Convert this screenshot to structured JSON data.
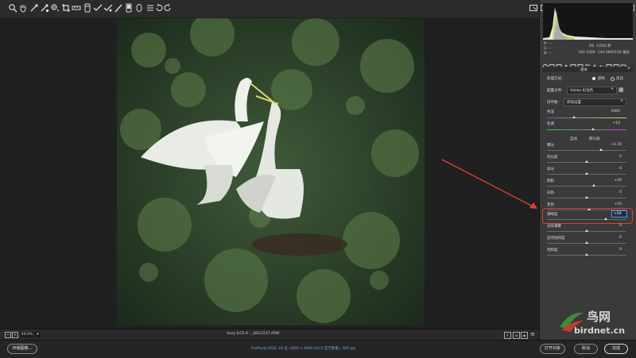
{
  "toolbar": {
    "icons": [
      "zoom-icon",
      "hand-icon",
      "white-balance-icon",
      "color-sampler-icon",
      "target-adjust-icon",
      "crop-icon",
      "straighten-icon",
      "spot-removal-icon",
      "red-eye-icon",
      "adjustment-brush-icon",
      "graduated-filter-icon",
      "radial-filter-icon",
      "rotate-left-icon",
      "rotate-right-icon"
    ]
  },
  "histogram": {
    "rgb": {
      "r": "R:",
      "g": "G:",
      "b": "B:",
      "r_val": "---",
      "g_val": "---",
      "b_val": "---"
    },
    "exif": {
      "aperture": "f/8",
      "shutter": "1/500 秒",
      "iso": "ISO 1000",
      "lens": "140-2800100 毫米"
    }
  },
  "panel": {
    "section_title": "基本",
    "treatment_label": "处理方式:",
    "treatment_color": "颜色",
    "treatment_bw": "黑白",
    "profile_label": "配置文件:",
    "profile_value": "Adobe 标准色",
    "wb_label": "白平衡:",
    "wb_value": "原照设置",
    "temp_label": "色温",
    "temp_value": "5000",
    "tint_label": "色调",
    "tint_value": "+10",
    "auto_label": "自动",
    "default_label": "默认值",
    "sliders": [
      {
        "label": "曝光",
        "value": "+1.30"
      },
      {
        "label": "对比度",
        "value": "0"
      },
      {
        "label": "高光",
        "value": "0"
      },
      {
        "label": "阴影",
        "value": "+26"
      },
      {
        "label": "白色",
        "value": "0"
      },
      {
        "label": "黑色",
        "value": "+10"
      }
    ],
    "highlight_slider": {
      "label": "清晰度",
      "value": "+50"
    },
    "more_sliders": [
      {
        "label": "去除薄雾",
        "value": "0"
      },
      {
        "label": "自然饱和度",
        "value": "0"
      },
      {
        "label": "饱和度",
        "value": "0"
      }
    ]
  },
  "status": {
    "zoom": "46.0%",
    "filename": "Sony ILCE-9 - _DSC2237.ARW"
  },
  "bottom": {
    "save_label": "存储图像...",
    "info_text": "ProPhoto RGB; 16 位; 4000 x 4000 (16.0 百万像素); 300 ppi",
    "open_label": "打开对象",
    "cancel_label": "取消",
    "done_label": "完成"
  },
  "watermark": {
    "cn": "鸟网",
    "url": "birdnet.cn"
  },
  "colors": {
    "annotation": "#d9412f",
    "panel_bg": "#3a3a3a",
    "canvas_bg": "#202020"
  }
}
